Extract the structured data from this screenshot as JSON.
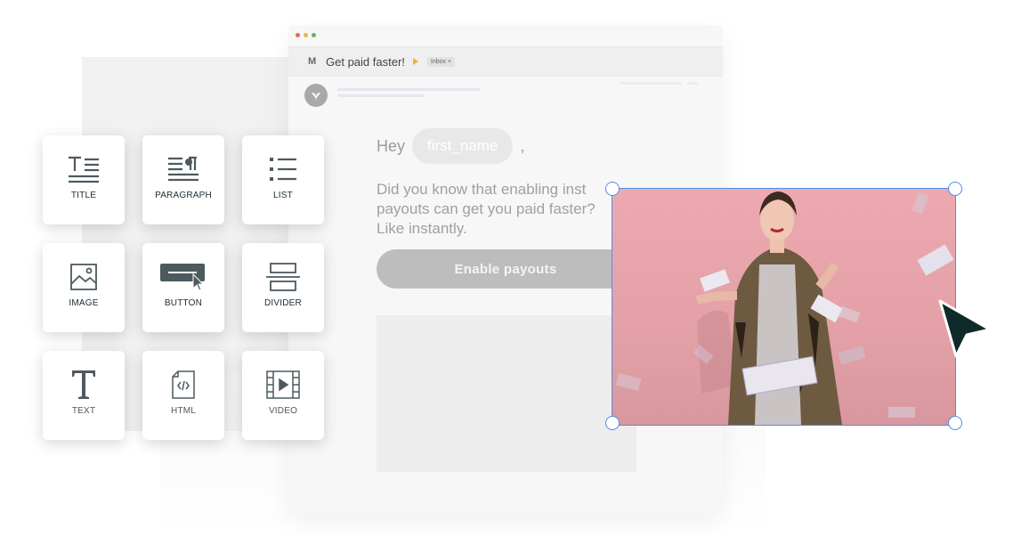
{
  "email": {
    "subject": "Get paid faster!",
    "inbox_label": "Inbox",
    "inbox_close": "×",
    "gmail_glyph": "M",
    "greeting": "Hey",
    "merge_tag": "first_name",
    "comma": ",",
    "body_lines": [
      "Did you know that enabling inst",
      "payouts can get you paid faster?",
      "Like instantly."
    ],
    "cta_label": "Enable payouts"
  },
  "blocks": [
    {
      "label": "TITLE",
      "icon": "title-icon"
    },
    {
      "label": "PARAGRAPH",
      "icon": "paragraph-icon"
    },
    {
      "label": "LIST",
      "icon": "list-icon"
    },
    {
      "label": "IMAGE",
      "icon": "image-icon"
    },
    {
      "label": "BUTTON",
      "icon": "button-icon"
    },
    {
      "label": "DIVIDER",
      "icon": "divider-icon"
    },
    {
      "label": "TEXT",
      "icon": "text-icon"
    },
    {
      "label": "HTML",
      "icon": "html-icon"
    },
    {
      "label": "VIDEO",
      "icon": "video-icon"
    }
  ],
  "colors": {
    "selection": "#4a8fe8",
    "cursor": "#0f2a2a",
    "tile_icon": "#4d5a5f",
    "importance": "#f1b42f"
  }
}
